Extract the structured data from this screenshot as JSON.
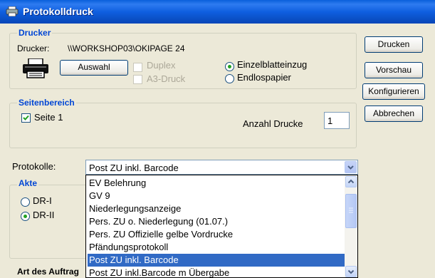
{
  "window": {
    "title": "Protokolldruck"
  },
  "drucker": {
    "group_label": "Drucker",
    "printer_label": "Drucker:",
    "printer_name": "\\\\WORKSHOP03\\OKIPAGE 24",
    "auswahl_label": "Auswahl",
    "duplex_label": "Duplex",
    "a3_label": "A3-Druck",
    "einzel_label": "Einzelblatteinzug",
    "endlos_label": "Endlospapier",
    "feed_selected": "Einzelblatteinzug"
  },
  "seitenbereich": {
    "group_label": "Seitenbereich",
    "seite1_label": "Seite 1",
    "seite1_checked": true,
    "anzahl_label": "Anzahl Drucke",
    "anzahl_value": "1"
  },
  "buttons": {
    "drucken": "Drucken",
    "vorschau": "Vorschau",
    "konfigurieren": "Konfigurieren",
    "abbrechen": "Abbrechen"
  },
  "protokolle": {
    "label": "Protokolle:",
    "selected": "Post ZU inkl. Barcode",
    "options": [
      "EV Belehrung",
      "GV 9",
      "Niederlegungsanzeige",
      "Pers. ZU o. Niederlegung (01.07.)",
      "Pers. ZU Offizielle gelbe Vordrucke",
      "Pfändungsprotokoll",
      "Post ZU inkl. Barcode",
      "Post ZU inkl.Barcode m Übergabe"
    ],
    "selected_index": 6
  },
  "akte": {
    "group_label": "Akte",
    "dr1_label": "DR-I",
    "dr2_label": "DR-II",
    "selected": "DR-II"
  },
  "auftrag": {
    "label": "Art des Auftrag"
  },
  "icons": {
    "title": "printer-small-icon",
    "printer": "printer-icon"
  },
  "colors": {
    "title_bar": "#0A5FDB",
    "group_label": "#0046D5",
    "selection": "#316AC5"
  }
}
